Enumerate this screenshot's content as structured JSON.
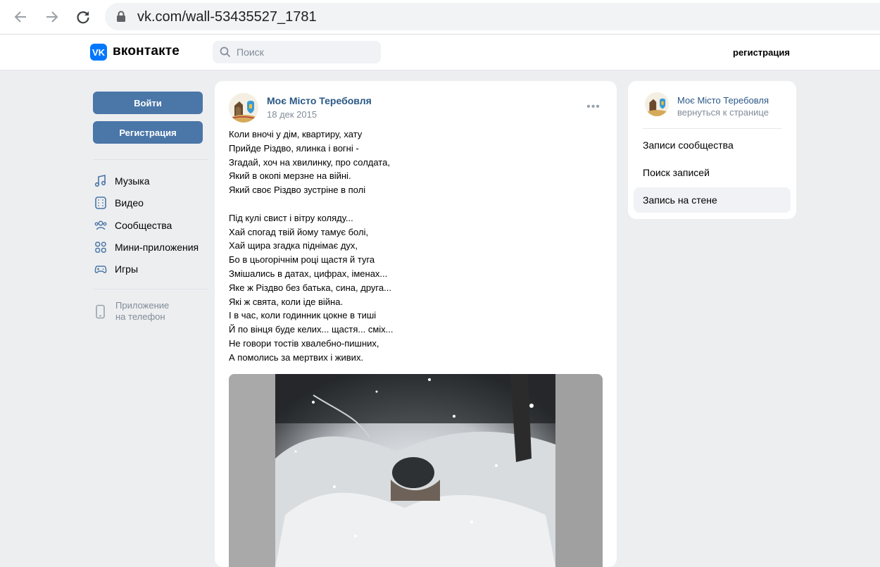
{
  "browser": {
    "url": "vk.com/wall-53435527_1781"
  },
  "header": {
    "logo_text": "вконтакте",
    "logo_mark": "VK",
    "search_placeholder": "Поиск",
    "register_link": "регистрация"
  },
  "sidebar": {
    "login_button": "Войти",
    "register_button": "Регистрация",
    "items": [
      {
        "label": "Музыка",
        "icon": "music-icon"
      },
      {
        "label": "Видео",
        "icon": "video-icon"
      },
      {
        "label": "Сообщества",
        "icon": "communities-icon"
      },
      {
        "label": "Мини-приложения",
        "icon": "mini-apps-icon"
      },
      {
        "label": "Игры",
        "icon": "games-icon"
      }
    ],
    "app_promo": {
      "line1": "Приложение",
      "line2": "на телефон"
    }
  },
  "post": {
    "author": "Моє Місто Теребовля",
    "date": "18 дек 2015",
    "lines": [
      "Коли вночі у дім, квартиру, хату",
      "Прийде Різдво, ялинка і вогні -",
      "Згадай, хоч на хвилинку, про солдата,",
      "Який в окопі мерзне на війні.",
      "Який своє Різдво зустріне в полі",
      "",
      "Під кулі свист і вітру коляду...",
      "Хай спогад твій йому тамує болі,",
      "Хай щира згадка піднімає дух,",
      "Бо в цьогорічнім році щастя й туга",
      "Змішались в датах, цифрах, іменах...",
      "Яке ж Різдво без батька, сина, друга...",
      "Які ж свята, коли іде війна.",
      "І в час, коли годинник цокне в тиші",
      "Й по вінця буде келих... щастя... сміх...",
      "Не говори тостів хвалебно-пишних,",
      "А помолись за мертвих і живих."
    ]
  },
  "right_card": {
    "community_name": "Моє Місто Теребовля",
    "back_link": "вернуться к странице",
    "items": [
      {
        "label": "Записи сообщества",
        "active": false
      },
      {
        "label": "Поиск записей",
        "active": false
      },
      {
        "label": "Запись на стене",
        "active": true
      }
    ]
  },
  "colors": {
    "accent": "#4a76a8",
    "link": "#2a5885",
    "vk_blue": "#0077ff",
    "page_bg": "#edeef0",
    "muted": "#818c99"
  }
}
